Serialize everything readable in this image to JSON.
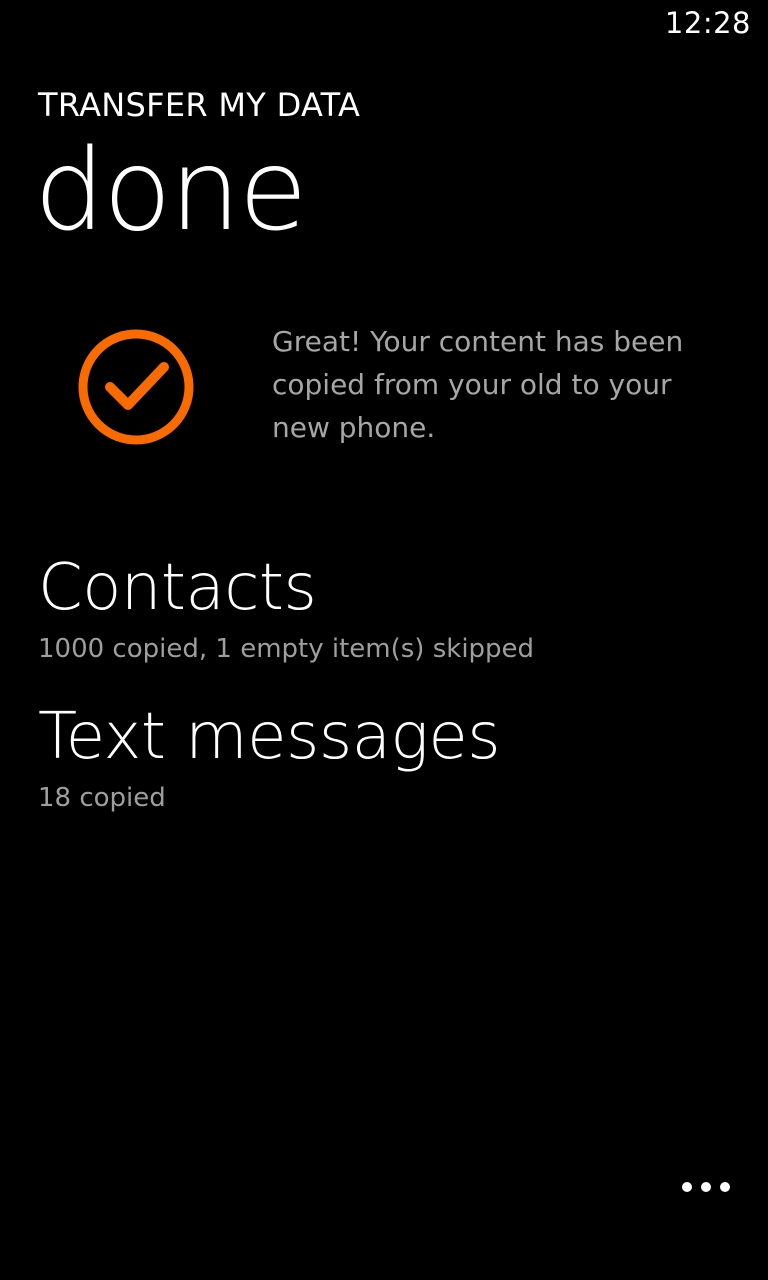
{
  "status_bar": {
    "time": "12:28"
  },
  "header": {
    "app_title": "TRANSFER MY DATA",
    "page_title": "done"
  },
  "summary": {
    "icon": "check-circle-icon",
    "message": "Great! Your content has been copied from your old to your new phone."
  },
  "results": [
    {
      "title": "Contacts",
      "detail": "1000 copied, 1 empty item(s) skipped"
    },
    {
      "title": "Text messages",
      "detail": "18 copied"
    }
  ],
  "app_bar": {
    "more_icon": "ellipsis-icon"
  },
  "colors": {
    "accent": "#f96b00",
    "background": "#000000",
    "text": "#ffffff",
    "subtle_text": "#a6a6a6"
  }
}
